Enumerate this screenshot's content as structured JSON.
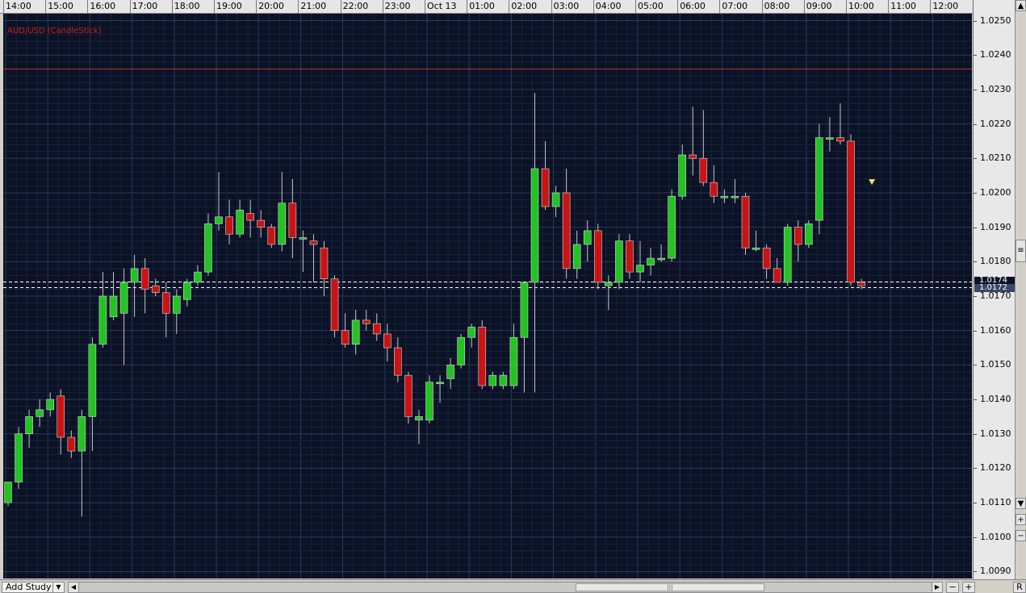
{
  "chart_title": "AUD/USD (CandleStick)",
  "time_labels": [
    "14:00",
    "15:00",
    "16:00",
    "17:00",
    "18:00",
    "19:00",
    "20:00",
    "21:00",
    "22:00",
    "23:00",
    "Oct 13",
    "01:00",
    "02:00",
    "03:00",
    "04:00",
    "05:00",
    "06:00",
    "07:00",
    "08:00",
    "09:00",
    "10:00",
    "11:00",
    "12:00"
  ],
  "price_labels": [
    "1.0250",
    "1.0240",
    "1.0230",
    "1.0220",
    "1.0210",
    "1.0200",
    "1.0190",
    "1.0180",
    "1.0170",
    "1.0160",
    "1.0150",
    "1.0140",
    "1.0130",
    "1.0120",
    "1.0110",
    "1.0100",
    "1.0090"
  ],
  "current_price_label": "1.0174",
  "secondary_price_label": "1.0172",
  "colors": {
    "up": "#22c322",
    "down": "#c81414",
    "background": "#0b1226",
    "grid": "#1f2e47",
    "resistance_line": "#b8322a",
    "dashed_line": "#ffffff"
  },
  "controls": {
    "add_study_label": "Add Study",
    "add_study_icon": "dropdown-arrow-icon",
    "scroll_left_icon": "arrow-left-icon",
    "scroll_right_icon": "arrow-right-icon",
    "scroll_grip_icon": "grip-icon",
    "zoom_out_label": "−",
    "zoom_in_label": "+",
    "reset_label": "R",
    "price_scroll_up_icon": "arrow-up-icon",
    "price_scroll_down_icon": "arrow-down-icon",
    "price_zoom_in_label": "+",
    "price_zoom_out_label": "−"
  },
  "chart_data": {
    "type": "candlestick",
    "title": "AUD/USD (CandleStick)",
    "interval": "15 minutes",
    "x_axis_labels": [
      "14:00",
      "15:00",
      "16:00",
      "17:00",
      "18:00",
      "19:00",
      "20:00",
      "21:00",
      "22:00",
      "23:00",
      "Oct 13",
      "01:00",
      "02:00",
      "03:00",
      "04:00",
      "05:00",
      "06:00",
      "07:00",
      "08:00",
      "09:00",
      "10:00",
      "11:00",
      "12:00"
    ],
    "ylim": [
      1.0088,
      1.0252
    ],
    "grid": true,
    "horizontal_lines": [
      {
        "price": 1.0236,
        "style": "solid",
        "color": "#b8322a"
      },
      {
        "price": 1.01743,
        "style": "dashed",
        "color": "#ffffff"
      },
      {
        "price": 1.01725,
        "style": "dashed",
        "color": "#ffffff"
      }
    ],
    "marker": {
      "candle_index": 82,
      "price": 1.0203,
      "shape": "down-triangle",
      "color": "#f0e06a"
    },
    "candles": [
      {
        "o": 1.011,
        "h": 1.0116,
        "l": 1.0109,
        "c": 1.0116
      },
      {
        "o": 1.0116,
        "h": 1.0132,
        "l": 1.0114,
        "c": 1.013
      },
      {
        "o": 1.013,
        "h": 1.0137,
        "l": 1.0126,
        "c": 1.0135
      },
      {
        "o": 1.0135,
        "h": 1.014,
        "l": 1.0132,
        "c": 1.0137
      },
      {
        "o": 1.0137,
        "h": 1.0142,
        "l": 1.0135,
        "c": 1.014
      },
      {
        "o": 1.0141,
        "h": 1.0143,
        "l": 1.0124,
        "c": 1.0129
      },
      {
        "o": 1.0129,
        "h": 1.0131,
        "l": 1.0123,
        "c": 1.0125
      },
      {
        "o": 1.0125,
        "h": 1.0137,
        "l": 1.0106,
        "c": 1.0135
      },
      {
        "o": 1.0135,
        "h": 1.0158,
        "l": 1.0125,
        "c": 1.0156
      },
      {
        "o": 1.0156,
        "h": 1.0177,
        "l": 1.0155,
        "c": 1.017
      },
      {
        "o": 1.0164,
        "h": 1.0177,
        "l": 1.0163,
        "c": 1.017
      },
      {
        "o": 1.0165,
        "h": 1.0178,
        "l": 1.015,
        "c": 1.0174
      },
      {
        "o": 1.0174,
        "h": 1.0182,
        "l": 1.0164,
        "c": 1.0178
      },
      {
        "o": 1.0178,
        "h": 1.0181,
        "l": 1.0165,
        "c": 1.0172
      },
      {
        "o": 1.0173,
        "h": 1.0175,
        "l": 1.017,
        "c": 1.0171
      },
      {
        "o": 1.0171,
        "h": 1.0174,
        "l": 1.0158,
        "c": 1.0165
      },
      {
        "o": 1.0165,
        "h": 1.0172,
        "l": 1.0159,
        "c": 1.017
      },
      {
        "o": 1.0169,
        "h": 1.0175,
        "l": 1.0167,
        "c": 1.0174
      },
      {
        "o": 1.0174,
        "h": 1.0179,
        "l": 1.0173,
        "c": 1.0177
      },
      {
        "o": 1.0177,
        "h": 1.0194,
        "l": 1.0176,
        "c": 1.0191
      },
      {
        "o": 1.0191,
        "h": 1.0206,
        "l": 1.0189,
        "c": 1.0193
      },
      {
        "o": 1.0193,
        "h": 1.0198,
        "l": 1.0185,
        "c": 1.0188
      },
      {
        "o": 1.0188,
        "h": 1.0198,
        "l": 1.0187,
        "c": 1.0195
      },
      {
        "o": 1.0194,
        "h": 1.0198,
        "l": 1.0187,
        "c": 1.0192
      },
      {
        "o": 1.0192,
        "h": 1.0195,
        "l": 1.0187,
        "c": 1.019
      },
      {
        "o": 1.019,
        "h": 1.0191,
        "l": 1.0184,
        "c": 1.0185
      },
      {
        "o": 1.0185,
        "h": 1.0206,
        "l": 1.0183,
        "c": 1.0197
      },
      {
        "o": 1.0197,
        "h": 1.0204,
        "l": 1.0181,
        "c": 1.0187
      },
      {
        "o": 1.0187,
        "h": 1.0189,
        "l": 1.0177,
        "c": 1.0187
      },
      {
        "o": 1.0186,
        "h": 1.0188,
        "l": 1.0174,
        "c": 1.0185
      },
      {
        "o": 1.0184,
        "h": 1.0186,
        "l": 1.017,
        "c": 1.0175
      },
      {
        "o": 1.0175,
        "h": 1.0176,
        "l": 1.0158,
        "c": 1.016
      },
      {
        "o": 1.016,
        "h": 1.0165,
        "l": 1.0155,
        "c": 1.0156
      },
      {
        "o": 1.0156,
        "h": 1.0166,
        "l": 1.0153,
        "c": 1.0163
      },
      {
        "o": 1.0163,
        "h": 1.0166,
        "l": 1.016,
        "c": 1.0162
      },
      {
        "o": 1.0162,
        "h": 1.0165,
        "l": 1.0157,
        "c": 1.0159
      },
      {
        "o": 1.0159,
        "h": 1.0162,
        "l": 1.0151,
        "c": 1.0155
      },
      {
        "o": 1.0155,
        "h": 1.0158,
        "l": 1.0145,
        "c": 1.0147
      },
      {
        "o": 1.0147,
        "h": 1.0148,
        "l": 1.0133,
        "c": 1.0135
      },
      {
        "o": 1.0134,
        "h": 1.0137,
        "l": 1.0127,
        "c": 1.0135
      },
      {
        "o": 1.0134,
        "h": 1.0147,
        "l": 1.0133,
        "c": 1.0145
      },
      {
        "o": 1.0145,
        "h": 1.0147,
        "l": 1.0139,
        "c": 1.0145
      },
      {
        "o": 1.0146,
        "h": 1.0152,
        "l": 1.0143,
        "c": 1.015
      },
      {
        "o": 1.015,
        "h": 1.0159,
        "l": 1.0149,
        "c": 1.0158
      },
      {
        "o": 1.0158,
        "h": 1.0162,
        "l": 1.0155,
        "c": 1.0161
      },
      {
        "o": 1.0161,
        "h": 1.0163,
        "l": 1.0143,
        "c": 1.0144
      },
      {
        "o": 1.0144,
        "h": 1.0148,
        "l": 1.0143,
        "c": 1.0147
      },
      {
        "o": 1.0144,
        "h": 1.0148,
        "l": 1.0143,
        "c": 1.0147
      },
      {
        "o": 1.0144,
        "h": 1.0162,
        "l": 1.0143,
        "c": 1.0158
      },
      {
        "o": 1.0158,
        "h": 1.0174,
        "l": 1.0142,
        "c": 1.0174
      },
      {
        "o": 1.0174,
        "h": 1.0229,
        "l": 1.0142,
        "c": 1.0207
      },
      {
        "o": 1.0207,
        "h": 1.0215,
        "l": 1.0195,
        "c": 1.0196
      },
      {
        "o": 1.0196,
        "h": 1.0202,
        "l": 1.0193,
        "c": 1.02
      },
      {
        "o": 1.02,
        "h": 1.0207,
        "l": 1.0175,
        "c": 1.0178
      },
      {
        "o": 1.0178,
        "h": 1.0189,
        "l": 1.0175,
        "c": 1.0185
      },
      {
        "o": 1.0185,
        "h": 1.0192,
        "l": 1.018,
        "c": 1.0189
      },
      {
        "o": 1.0189,
        "h": 1.0191,
        "l": 1.0172,
        "c": 1.0174
      },
      {
        "o": 1.0173,
        "h": 1.0176,
        "l": 1.0166,
        "c": 1.0174
      },
      {
        "o": 1.0174,
        "h": 1.0188,
        "l": 1.0172,
        "c": 1.0186
      },
      {
        "o": 1.0186,
        "h": 1.0188,
        "l": 1.0175,
        "c": 1.0177
      },
      {
        "o": 1.0177,
        "h": 1.0186,
        "l": 1.0174,
        "c": 1.0179
      },
      {
        "o": 1.0179,
        "h": 1.0184,
        "l": 1.0176,
        "c": 1.0181
      },
      {
        "o": 1.0181,
        "h": 1.0185,
        "l": 1.018,
        "c": 1.0181
      },
      {
        "o": 1.0181,
        "h": 1.0201,
        "l": 1.018,
        "c": 1.0199
      },
      {
        "o": 1.0199,
        "h": 1.0214,
        "l": 1.0198,
        "c": 1.0211
      },
      {
        "o": 1.0211,
        "h": 1.0225,
        "l": 1.0205,
        "c": 1.021
      },
      {
        "o": 1.021,
        "h": 1.0224,
        "l": 1.0202,
        "c": 1.0203
      },
      {
        "o": 1.0203,
        "h": 1.0208,
        "l": 1.0197,
        "c": 1.0199
      },
      {
        "o": 1.0199,
        "h": 1.0201,
        "l": 1.0197,
        "c": 1.0199
      },
      {
        "o": 1.0199,
        "h": 1.0204,
        "l": 1.0197,
        "c": 1.0199
      },
      {
        "o": 1.0199,
        "h": 1.02,
        "l": 1.0182,
        "c": 1.0184
      },
      {
        "o": 1.0184,
        "h": 1.0189,
        "l": 1.0183,
        "c": 1.0184
      },
      {
        "o": 1.0184,
        "h": 1.0185,
        "l": 1.0175,
        "c": 1.0178
      },
      {
        "o": 1.0178,
        "h": 1.0181,
        "l": 1.0174,
        "c": 1.0174
      },
      {
        "o": 1.0174,
        "h": 1.0191,
        "l": 1.0173,
        "c": 1.019
      },
      {
        "o": 1.019,
        "h": 1.0192,
        "l": 1.018,
        "c": 1.0185
      },
      {
        "o": 1.0185,
        "h": 1.0192,
        "l": 1.0184,
        "c": 1.0191
      },
      {
        "o": 1.0192,
        "h": 1.022,
        "l": 1.0188,
        "c": 1.0216
      },
      {
        "o": 1.0216,
        "h": 1.0222,
        "l": 1.0212,
        "c": 1.0216
      },
      {
        "o": 1.0216,
        "h": 1.0226,
        "l": 1.0214,
        "c": 1.0215
      },
      {
        "o": 1.0215,
        "h": 1.0217,
        "l": 1.0173,
        "c": 1.0174
      },
      {
        "o": 1.0174,
        "h": 1.0175,
        "l": 1.0172,
        "c": 1.0173
      }
    ]
  }
}
